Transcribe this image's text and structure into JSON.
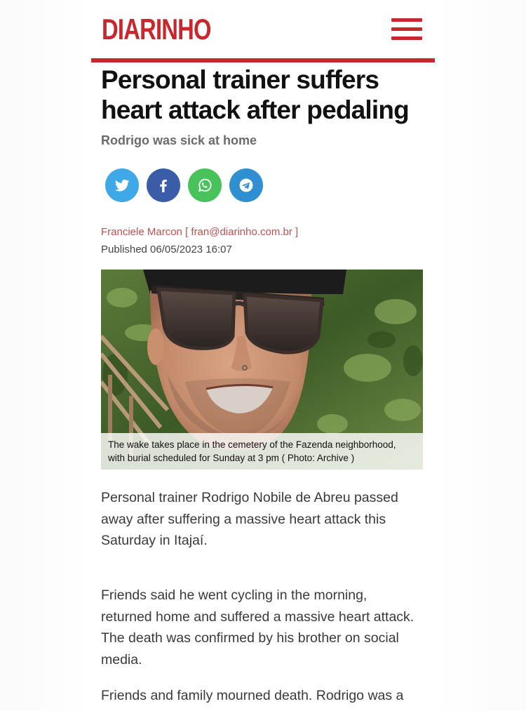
{
  "header": {
    "logo_text": "DIARINHO",
    "menu_icon": "hamburger-menu-icon",
    "brand_color": "#c8282d"
  },
  "article": {
    "title_lines": [
      "Personal trainer suffers",
      "heart attack after pedaling"
    ],
    "subtitle": "Rodrigo was sick at home",
    "author": "Franciele Marcon [ fran@diarinho.com.br ]",
    "published": "Published 06/05/2023 16:07",
    "photo": {
      "caption_lines": [
        "The wake takes place in the cemetery of the Fazenda neighborhood,",
        "with burial scheduled for Sunday at 3 pm ( Photo: Archive )"
      ]
    },
    "paragraphs": [
      {
        "lines": [
          "Personal trainer Rodrigo Nobile de Abreu passed",
          "away after suffering a massive heart attack this",
          "Saturday in Itajaí."
        ]
      },
      {
        "lines": [
          "Friends said he went cycling in the morning,",
          "returned home and suffered a massive heart attack.",
          "The death was confirmed by his brother on social",
          "media."
        ]
      },
      {
        "lines": [
          "Friends and family mourned death. Rodrigo was a"
        ]
      }
    ]
  },
  "share": [
    {
      "icon": "twitter-icon",
      "color": "#3fa9e8"
    },
    {
      "icon": "facebook-icon",
      "color": "#3b5da8"
    },
    {
      "icon": "whatsapp-icon",
      "color": "#48c25b"
    },
    {
      "icon": "telegram-icon",
      "color": "#2f8fd0"
    }
  ]
}
